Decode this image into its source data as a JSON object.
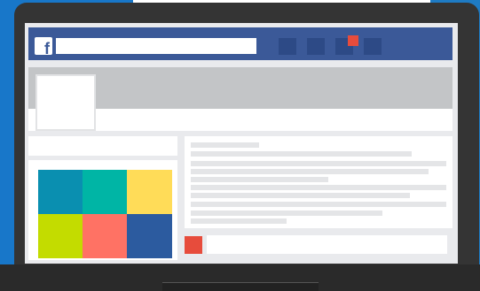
{
  "app": {
    "logo": {
      "icon": "facebook-f-icon",
      "glyph": "f",
      "color": "#3b5998"
    }
  },
  "header": {
    "search": {
      "value": "",
      "placeholder": ""
    },
    "nav_icons": [
      "friends-icon",
      "messages-icon",
      "notifications-icon",
      "settings-icon"
    ],
    "notification_color": "#e74c3c"
  },
  "profile": {
    "cover_color": "#c3c5c7"
  },
  "photos": {
    "tiles": [
      "#0a8fb0",
      "#00b5a5",
      "#ffdc58",
      "#c3dc00",
      "#ff7264",
      "#2c5b9f"
    ]
  },
  "composer": {
    "avatar_color": "#e74c3c",
    "value": "",
    "placeholder": ""
  },
  "colors": {
    "brand": "#3b5998",
    "page_bg": "#e9eaed",
    "placeholder_line": "#e4e5e7"
  }
}
